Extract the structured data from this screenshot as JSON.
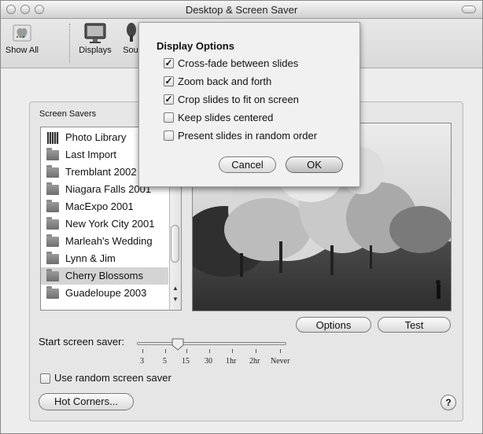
{
  "window": {
    "title": "Desktop & Screen Saver"
  },
  "toolbar": {
    "items": [
      {
        "label": "Show All",
        "icon": "show-all-icon"
      },
      {
        "label": "Displays",
        "icon": "displays-icon"
      },
      {
        "label": "Sou",
        "icon": "sound-icon"
      }
    ]
  },
  "screen_savers": {
    "label": "Screen Savers",
    "items": [
      {
        "label": "Photo Library",
        "icon": "photo-library-icon",
        "selected": false
      },
      {
        "label": "Last Import",
        "icon": "folder-icon",
        "selected": false
      },
      {
        "label": "Tremblant 2002",
        "icon": "folder-icon",
        "selected": false
      },
      {
        "label": "Niagara Falls 2001",
        "icon": "folder-icon",
        "selected": false
      },
      {
        "label": "MacExpo 2001",
        "icon": "folder-icon",
        "selected": false
      },
      {
        "label": "New York City 2001",
        "icon": "folder-icon",
        "selected": false
      },
      {
        "label": "Marleah's Wedding",
        "icon": "folder-icon",
        "selected": false
      },
      {
        "label": "Lynn & Jim",
        "icon": "folder-icon",
        "selected": false
      },
      {
        "label": "Cherry Blossoms",
        "icon": "folder-icon",
        "selected": true
      },
      {
        "label": "Guadeloupe 2003",
        "icon": "folder-icon",
        "selected": false
      }
    ]
  },
  "buttons": {
    "options": "Options",
    "test": "Test",
    "hot_corners": "Hot Corners...",
    "help": "?"
  },
  "start_saver": {
    "label": "Start screen saver:",
    "ticks": [
      "3",
      "5",
      "15",
      "30",
      "1hr",
      "2hr",
      "Never"
    ],
    "selected_index": 1.5
  },
  "random_saver": {
    "label": "Use random screen saver",
    "checked": false
  },
  "display_options": {
    "title": "Display Options",
    "options": [
      {
        "label": "Cross-fade between slides",
        "checked": true
      },
      {
        "label": "Zoom back and forth",
        "checked": true
      },
      {
        "label": "Crop slides to fit on screen",
        "checked": true
      },
      {
        "label": "Keep slides centered",
        "checked": false
      },
      {
        "label": "Present slides in random order",
        "checked": false
      }
    ],
    "cancel": "Cancel",
    "ok": "OK"
  }
}
